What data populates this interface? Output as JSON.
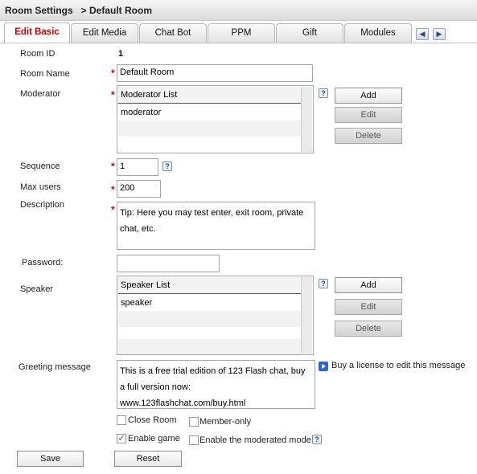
{
  "header": {
    "title": "Room Settings   > Default Room"
  },
  "tabs": [
    {
      "label": "Edit Basic",
      "active": true
    },
    {
      "label": "Edit Media"
    },
    {
      "label": "Chat Bot"
    },
    {
      "label": "PPM"
    },
    {
      "label": "Gift"
    },
    {
      "label": "Modules"
    }
  ],
  "form": {
    "room_id": {
      "label": "Room ID",
      "value": "1"
    },
    "room_name": {
      "label": "Room Name",
      "value": "Default Room",
      "required": "*"
    },
    "moderator": {
      "label": "Moderator",
      "required": "*",
      "list_header": "Moderator List",
      "items": [
        "moderator"
      ],
      "add": "Add",
      "edit": "Edit",
      "delete": "Delete",
      "help": "?"
    },
    "sequence": {
      "label": "Sequence",
      "value": "1",
      "required": "*",
      "help": "?"
    },
    "max_users": {
      "label": "Max users",
      "value": "200",
      "required": "*"
    },
    "description": {
      "label": "Description",
      "value": "Tip: Here you may test enter, exit room, private chat, etc.",
      "required": "*"
    },
    "password": {
      "label": "Password:",
      "value": ""
    },
    "speaker": {
      "label": "Speaker",
      "list_header": "Speaker List",
      "items": [
        "speaker"
      ],
      "add": "Add",
      "edit": "Edit",
      "delete": "Delete",
      "help": "?"
    },
    "greeting": {
      "label": "Greeting message",
      "value": "This is a free trial edition of 123 Flash chat, buy a full version now: www.123flashchat.com/buy.html",
      "license_link": "Buy a license to edit this message"
    },
    "options": {
      "close_room": {
        "label": "Close Room",
        "checked": false
      },
      "member_only": {
        "label": "Member-only",
        "checked": false
      },
      "enable_game": {
        "label": "Enable game",
        "checked": true
      },
      "moderated_mode": {
        "label": "Enable the moderated mode",
        "checked": false,
        "help": "?"
      }
    }
  },
  "actions": {
    "save": "Save",
    "reset": "Reset"
  },
  "icons": {
    "prev": "arrow-left-icon",
    "next": "arrow-right-icon",
    "help": "help-icon",
    "play": "play-icon",
    "check": "checkmark-icon"
  },
  "colors": {
    "active_tab": "#cc0000",
    "required": "#d60000",
    "play_icon": "#2d66c6"
  }
}
